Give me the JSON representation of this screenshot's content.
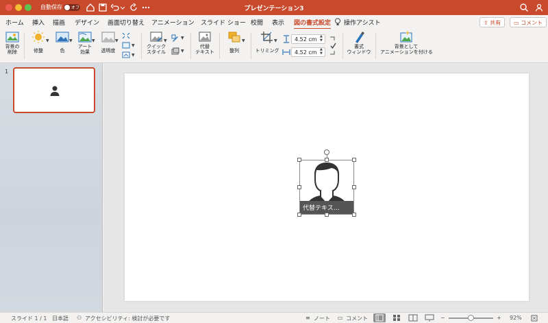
{
  "titlebar": {
    "autosave_label": "自動保存",
    "autosave_state": "オフ",
    "document_title": "プレゼンテーション3"
  },
  "tabs": [
    {
      "label": "ホーム"
    },
    {
      "label": "挿入"
    },
    {
      "label": "描画"
    },
    {
      "label": "デザイン"
    },
    {
      "label": "画面切り替え"
    },
    {
      "label": "アニメーション"
    },
    {
      "label": "スライド ショー"
    },
    {
      "label": "校閲"
    },
    {
      "label": "表示"
    },
    {
      "label": "図の書式設定",
      "active": true
    },
    {
      "label": "操作アシスト"
    }
  ],
  "header_buttons": {
    "share": "共有",
    "comment": "コメント"
  },
  "ribbon": {
    "remove_background": [
      "背景の",
      "削除"
    ],
    "corrections": "修整",
    "color": "色",
    "artistic_effects": [
      "アート",
      "効果"
    ],
    "transparency": "透明度",
    "quick_styles": [
      "クイック",
      "スタイル"
    ],
    "alt_text": [
      "代替",
      "テキスト"
    ],
    "arrange": "整列",
    "crop": "トリミング",
    "height_value": "4.52 cm",
    "width_value": "4.52 cm",
    "format_pane": [
      "書式",
      "ウィンドウ"
    ],
    "set_as_background": [
      "背景として",
      "アニメーションを付ける"
    ]
  },
  "slides_pane": {
    "slide_number": "1"
  },
  "picture": {
    "alt_text_overlay": "代替テキス…"
  },
  "statusbar": {
    "slide_info": "スライド 1 / 1",
    "language": "日本語",
    "accessibility": "アクセシビリティ: 検討が必要です",
    "notes": "ノート",
    "comments": "コメント",
    "zoom_minus": "−",
    "zoom_plus": "+",
    "zoom_level": "92%"
  },
  "colors": {
    "accent": "#c9492c",
    "titlebar": "#c9492c",
    "ribbon_bg": "#f3f2f1"
  }
}
